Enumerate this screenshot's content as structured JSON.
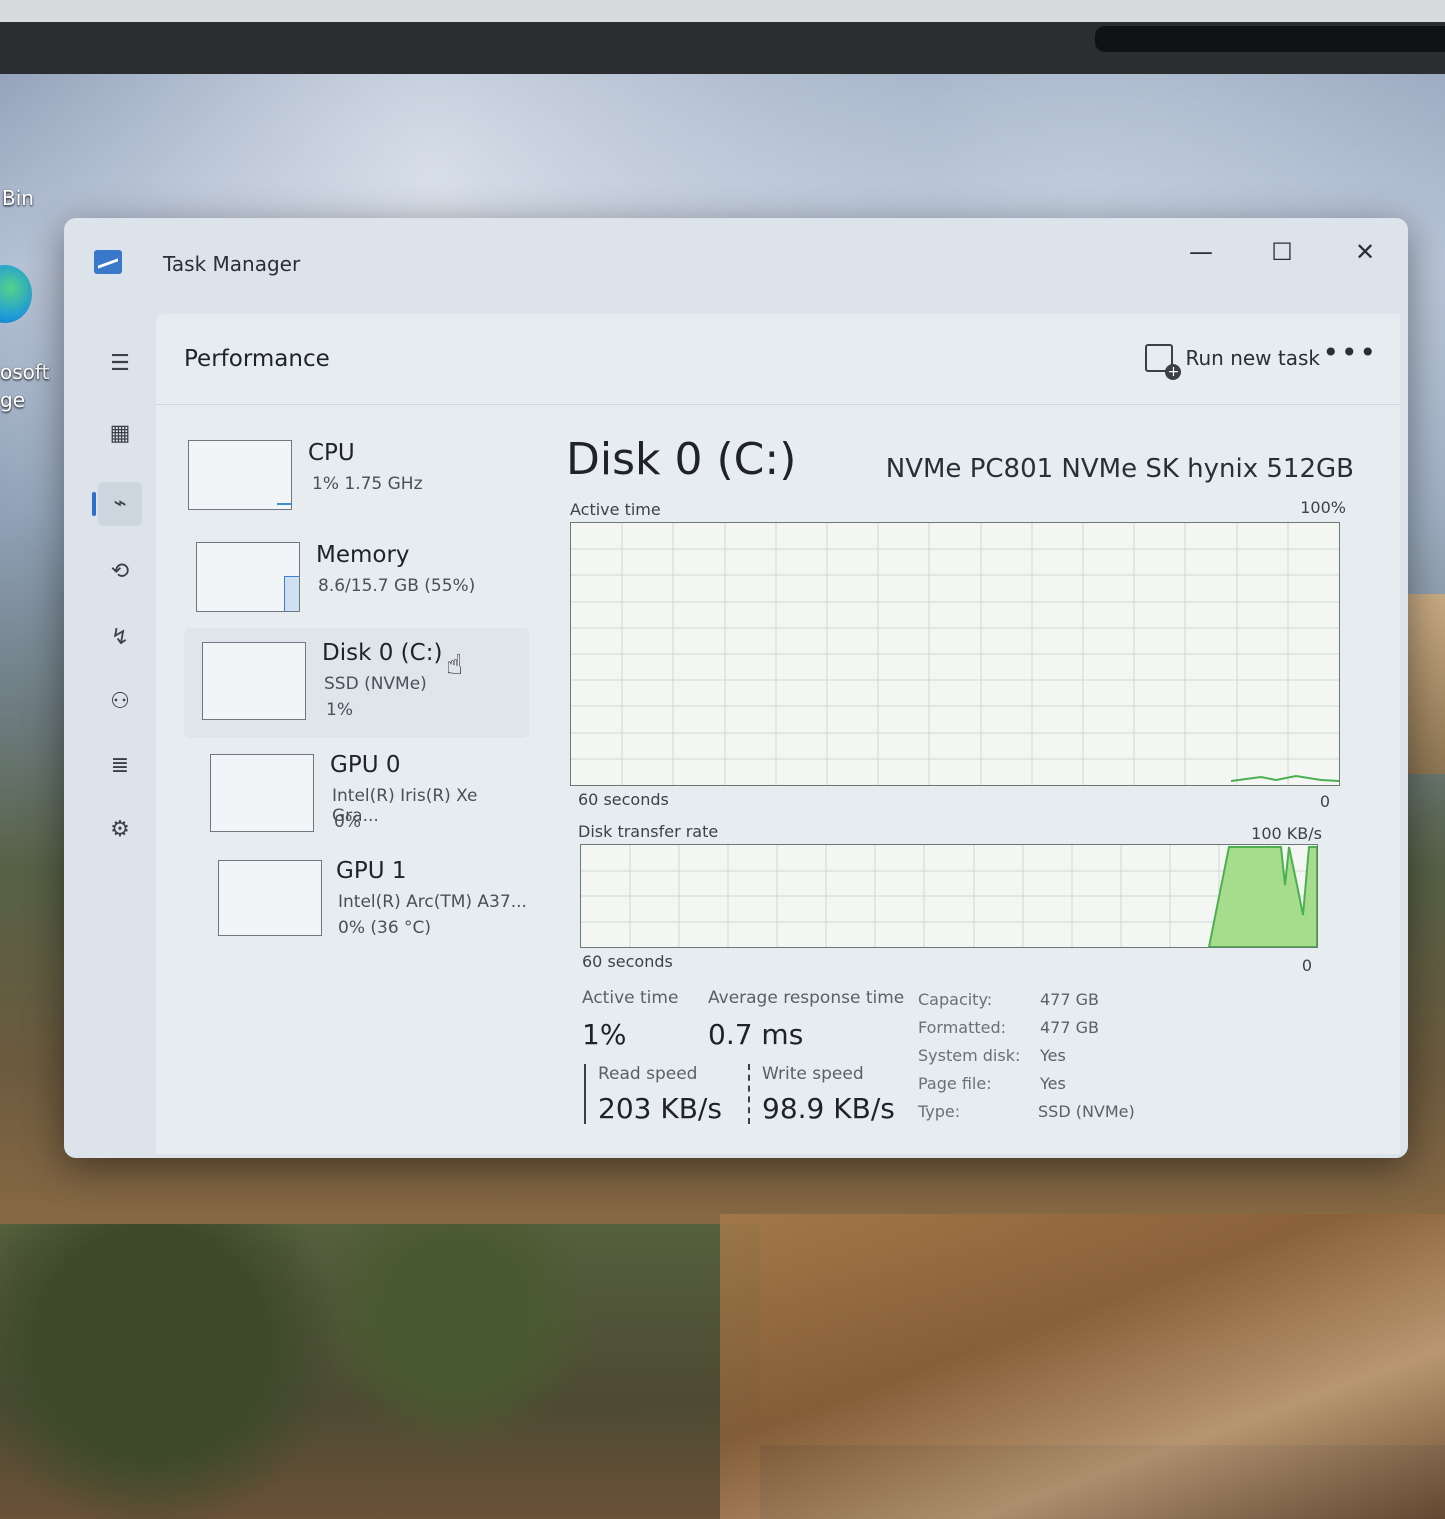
{
  "desktop": {
    "icons": [
      {
        "label_lines": [
          "Bin"
        ]
      },
      {
        "label_lines": [
          "osoft",
          "ge"
        ]
      }
    ]
  },
  "window": {
    "title": "Task Manager",
    "controls": {
      "minimize": "—",
      "maximize": "☐",
      "close": "✕"
    }
  },
  "nav": {
    "items": [
      {
        "name": "hamburger",
        "icon": "☰"
      },
      {
        "name": "processes",
        "icon": "▦"
      },
      {
        "name": "performance",
        "icon": "⌁",
        "active": true
      },
      {
        "name": "app-history",
        "icon": "⟲"
      },
      {
        "name": "startup-apps",
        "icon": "↯"
      },
      {
        "name": "users",
        "icon": "⚇"
      },
      {
        "name": "details",
        "icon": "≣"
      },
      {
        "name": "services",
        "icon": "⚙"
      }
    ],
    "settings_icon": "⚙"
  },
  "header": {
    "title": "Performance",
    "run_new_task": "Run new task",
    "more": "•••"
  },
  "devices": [
    {
      "name": "CPU",
      "line1": "1%  1.75 GHz",
      "line2": ""
    },
    {
      "name": "Memory",
      "line1": "8.6/15.7 GB (55%)",
      "line2": "",
      "fill_fraction": 0.55
    },
    {
      "name": "Disk 0 (C:)",
      "line1": "SSD (NVMe)",
      "line2": "1%",
      "selected": true
    },
    {
      "name": "GPU 0",
      "line1": "Intel(R) Iris(R) Xe Gra...",
      "line2": "0%"
    },
    {
      "name": "GPU 1",
      "line1": "Intel(R) Arc(TM) A37...",
      "line2": "0%  (36 °C)"
    }
  ],
  "detail": {
    "title": "Disk 0 (C:)",
    "model": "NVMe PC801 NVMe SK hynix 512GB",
    "active_graph": {
      "label": "Active time",
      "max": "100%",
      "time": "60 seconds",
      "min": "0"
    },
    "transfer_graph": {
      "label": "Disk transfer rate",
      "max": "100 KB/s",
      "time": "60 seconds",
      "min": "0"
    },
    "stats": {
      "active_time_label": "Active time",
      "active_time": "1%",
      "avg_response_label": "Average response time",
      "avg_response": "0.7 ms",
      "read_label": "Read speed",
      "read": "203 KB/s",
      "write_label": "Write speed",
      "write": "98.9 KB/s"
    },
    "properties": [
      {
        "key": "Capacity:",
        "value": "477 GB"
      },
      {
        "key": "Formatted:",
        "value": "477 GB"
      },
      {
        "key": "System disk:",
        "value": "Yes"
      },
      {
        "key": "Page file:",
        "value": "Yes"
      },
      {
        "key": "Type:",
        "value": "SSD (NVMe)"
      }
    ]
  },
  "colors": {
    "accent": "#2f6fd0",
    "disk_graph_line": "#4caf50",
    "disk_graph_fill": "#a6dd8c"
  }
}
